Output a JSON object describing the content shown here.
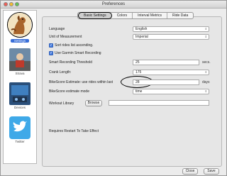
{
  "window": {
    "title": "Preferences"
  },
  "sidebar": {
    "items": [
      {
        "label": "Settings",
        "icon": "dog-settings-icon",
        "selected": true
      },
      {
        "label": "Strava",
        "icon": "strava-icon",
        "selected": false
      },
      {
        "label": "Devices",
        "icon": "devices-icon",
        "selected": false
      },
      {
        "label": "Twitter",
        "icon": "twitter-bird-icon",
        "selected": false
      }
    ]
  },
  "tabs": [
    "Basic Settings",
    "Colors",
    "Interval Metrics",
    "Ride Data"
  ],
  "fields": {
    "language": {
      "label": "Language",
      "value": "English"
    },
    "units": {
      "label": "Unit of Measurement",
      "value": "Imperial"
    },
    "sort_rides": {
      "label": "Sort rides list ascending.",
      "checked": true
    },
    "garmin_smart": {
      "label": "Use Garmin Smart Recording",
      "checked": true
    },
    "smart_threshold": {
      "label": "Smart Recording Threshold",
      "value": "25",
      "unit": "secs."
    },
    "crank_length": {
      "label": "Crank Length:",
      "value": "175"
    },
    "bikescore_days": {
      "label": "BikeScore Estimate: use rides within last",
      "value": "28",
      "unit": "days"
    },
    "bikescore_mode": {
      "label": "BikeScore estimate mode",
      "value": "time"
    },
    "workout_library": {
      "label": "Workout Library",
      "button": "Browse"
    },
    "restart_note": "Requires Restart To Take Effect"
  },
  "buttons": {
    "close": "Close",
    "save": "Save"
  },
  "colors": {
    "accent": "#3a6fd8",
    "checkbox": "#4a7fe0"
  }
}
